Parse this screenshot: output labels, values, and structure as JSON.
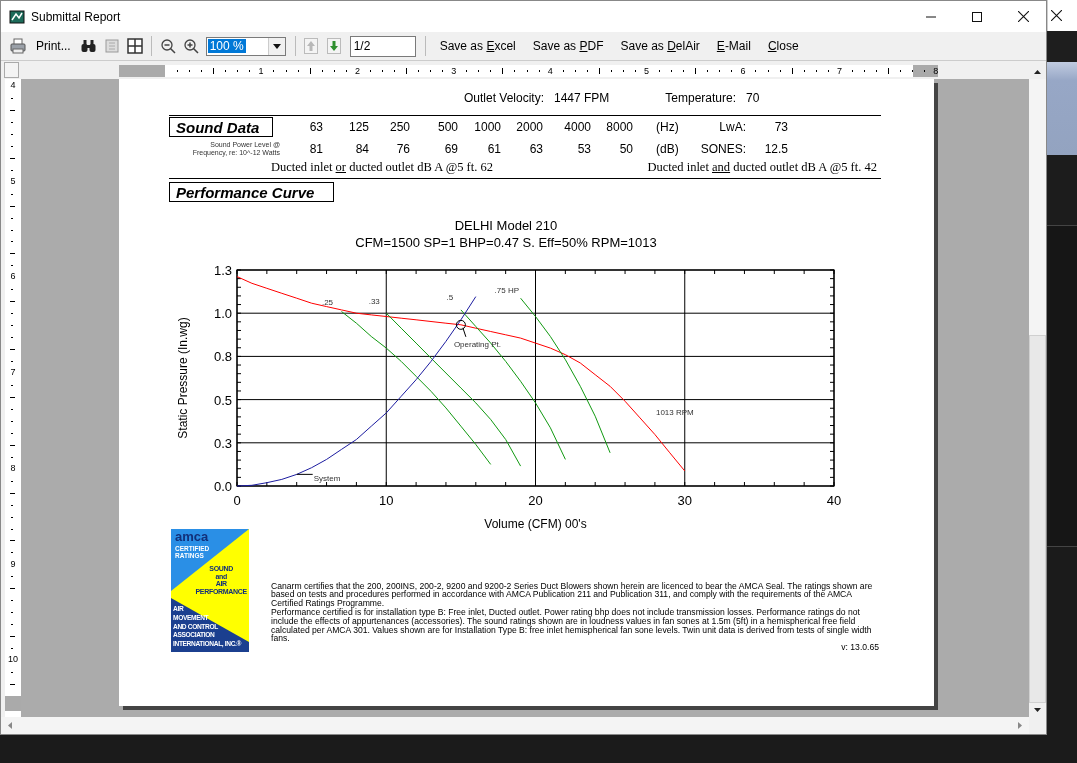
{
  "window": {
    "title": "Submittal Report"
  },
  "toolbar": {
    "print_label": "Print...",
    "zoom": {
      "value": "100 %",
      "highlighted": true
    },
    "prev_page": {
      "disabled": true
    },
    "next_page": {
      "disabled": false
    },
    "page": "1/2",
    "buttons": [
      {
        "before": "Save as ",
        "key": "E",
        "rest": "xcel"
      },
      {
        "before": "Save as ",
        "key": "P",
        "rest": "DF"
      },
      {
        "before": "Save as ",
        "key": "D",
        "rest": "elAir"
      },
      {
        "key": "E",
        "rest": "-Mail"
      },
      {
        "key": "C",
        "rest": "lose"
      }
    ]
  },
  "rulers": {
    "horizontal": [
      "1",
      "2",
      "3",
      "4",
      "5",
      "6",
      "7",
      "8"
    ],
    "vertical": [
      "4",
      "5",
      "6",
      "7",
      "8",
      "9",
      "10"
    ]
  },
  "report": {
    "summary": [
      {
        "label": "Outlet Velocity:",
        "value": "1447 FPM"
      },
      {
        "label": "Temperature:",
        "value": "70"
      }
    ],
    "sound_data": {
      "heading": "Sound Data",
      "caption_lines": [
        "Sound Power Level @",
        "Frequency, re: 10^-12 Watts"
      ],
      "frequencies": [
        "63",
        "125",
        "250",
        "500",
        "1000",
        "2000",
        "4000",
        "8000"
      ],
      "frequency_unit": "(Hz)",
      "lwa_label": "LwA:",
      "lwa": "73",
      "levels": [
        "81",
        "84",
        "76",
        "69",
        "61",
        "63",
        "53",
        "50"
      ],
      "level_unit": "(dB)",
      "sones_label": "SONES:",
      "sones": "12.5",
      "notes": [
        {
          "before": "Ducted inlet ",
          "underlined": "or",
          "after": " ducted outlet dB A @5 ft. 62"
        },
        {
          "before": "Ducted inlet ",
          "underlined": "and",
          "after": " ducted outlet dB A @5 ft. 42"
        }
      ]
    },
    "performance": {
      "heading": "Performance Curve",
      "chart_data": {
        "type": "line",
        "title": "DELHI Model 210",
        "subtitle": "CFM=1500  SP=1  BHP=0.47  S. Eff=50% RPM=1013",
        "xlabel": "Volume (CFM) 00's",
        "ylabel": "Static Pressure (In.wg)",
        "grid": true,
        "x": [
          0,
          1,
          2,
          3,
          4,
          5,
          6,
          7,
          8,
          9,
          10,
          11,
          12,
          13,
          14,
          15,
          16,
          17,
          18,
          19,
          20,
          21,
          22,
          23,
          24,
          25,
          26,
          27,
          28,
          29,
          30
        ],
        "series": [
          {
            "color": "#ff0000",
            "values": [
              1.26,
              1.22,
              1.19,
              1.16,
              1.13,
              1.1,
              1.08,
              1.06,
              1.04,
              1.03,
              1.02,
              1.01,
              1.0,
              0.99,
              0.98,
              0.97,
              0.95,
              0.93,
              0.91,
              0.89,
              0.86,
              0.83,
              0.79,
              0.74,
              0.67,
              0.6,
              0.51,
              0.41,
              0.31,
              0.2,
              0.09
            ]
          },
          {
            "color": "#119911",
            "values": [
              null,
              null,
              null,
              null,
              null,
              null,
              null,
              1.05,
              0.98,
              0.9,
              0.83,
              0.75,
              0.66,
              0.57,
              0.47,
              0.36,
              0.25,
              0.13,
              null,
              null,
              null,
              null,
              null,
              null,
              null,
              null,
              null,
              null,
              null,
              null,
              null
            ]
          },
          {
            "color": "#119911",
            "values": [
              null,
              null,
              null,
              null,
              null,
              null,
              null,
              null,
              null,
              null,
              1.04,
              0.95,
              0.86,
              0.77,
              0.68,
              0.59,
              0.5,
              0.4,
              0.28,
              0.12,
              null,
              null,
              null,
              null,
              null,
              null,
              null,
              null,
              null,
              null,
              null
            ]
          },
          {
            "color": "#119911",
            "values": [
              null,
              null,
              null,
              null,
              null,
              null,
              null,
              null,
              null,
              null,
              null,
              null,
              null,
              null,
              null,
              1.06,
              0.96,
              0.86,
              0.75,
              0.63,
              0.5,
              0.35,
              0.16,
              null,
              null,
              null,
              null,
              null,
              null,
              null,
              null
            ]
          },
          {
            "color": "#119911",
            "values": [
              null,
              null,
              null,
              null,
              null,
              null,
              null,
              null,
              null,
              null,
              null,
              null,
              null,
              null,
              null,
              null,
              null,
              null,
              null,
              1.13,
              1.02,
              0.9,
              0.76,
              0.6,
              0.42,
              0.2,
              null,
              null,
              null,
              null,
              null
            ]
          },
          {
            "color": "#1c1ca0",
            "values": [
              0,
              0.004,
              0.02,
              0.04,
              0.07,
              0.11,
              0.16,
              0.22,
              0.28,
              0.36,
              0.44,
              0.54,
              0.64,
              0.75,
              0.87,
              1.0,
              1.14,
              null,
              null,
              null,
              null,
              null,
              null,
              null,
              null,
              null,
              null,
              null,
              null,
              null,
              null
            ]
          }
        ],
        "xlim": [
          0,
          40
        ],
        "ylim": [
          0,
          1.3
        ],
        "xticks": [
          0,
          10,
          20,
          30,
          40
        ],
        "yticks": [
          {
            "value": 0,
            "label": "0.0"
          },
          {
            "value": 0.26,
            "label": "0.3"
          },
          {
            "value": 0.52,
            "label": "0.5"
          },
          {
            "value": 0.78,
            "label": "0.8"
          },
          {
            "value": 1.04,
            "label": "1.0"
          },
          {
            "value": 1.3,
            "label": "1.3"
          }
        ],
        "annotations": [
          {
            "text": "Operating Pt.",
            "x": 15,
            "y": 0.97
          },
          {
            "text": "System",
            "x": 4,
            "y": 0.07
          },
          {
            "text": ".25",
            "x": 7,
            "y": 1.05
          },
          {
            "text": ".33",
            "x": 10,
            "y": 1.04
          },
          {
            "text": ".5",
            "x": 15,
            "y": 1.06
          },
          {
            "text": ".75 HP",
            "x": 19,
            "y": 1.13
          },
          {
            "text": "1013 RPM",
            "x": 27,
            "y": 0.41
          }
        ]
      }
    },
    "logo": {
      "name": "amca",
      "lines_top": [
        "CERTIFIED",
        "RATINGS"
      ],
      "lines_middle": [
        "SOUND",
        "and",
        "AIR",
        "PERFORMANCE"
      ],
      "lines_bottom": [
        "AIR",
        "MOVEMENT",
        "AND CONTROL",
        "ASSOCIATION",
        "INTERNATIONAL, INC.®"
      ]
    },
    "footnote": {
      "paragraphs": [
        "Canarm certifies that the 200, 200INS, 200-2, 9200 and 9200-2 Series Duct Blowers shown herein are licenced to bear the AMCA Seal. The ratings shown are based on tests and procedures performed in accordance with AMCA Publication 211 and Publication 311, and comply with the requirements of the AMCA Certified Ratings Programme.",
        "Performance certified is for installation type B: Free inlet, Ducted outlet. Power rating bhp does not include transmission losses. Performance ratings do not include the effects of appurtenances (accessories). The sound ratings shown are in loudness values in fan sones at 1.5m (5ft) in a hemispherical free field calculated per AMCA 301. Values shown are for Installation Type B: free inlet hemispherical fan sone levels. Twin unit data is derived from tests of single width fans."
      ],
      "version": "v: 13.0.65"
    }
  }
}
